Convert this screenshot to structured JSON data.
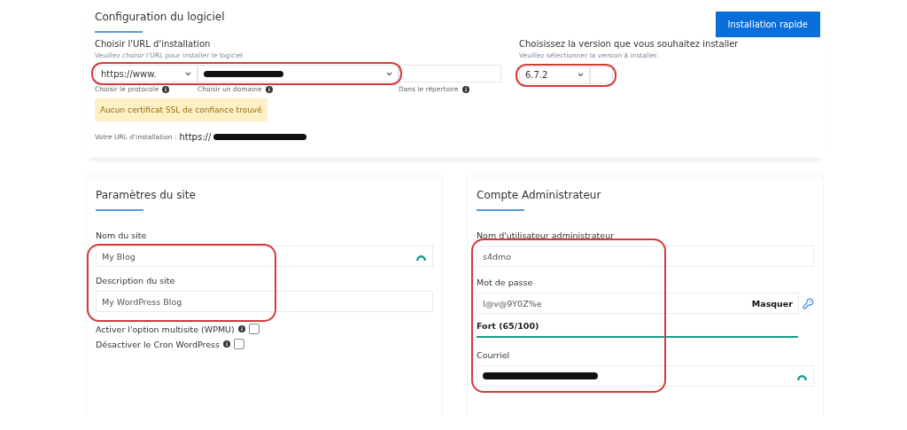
{
  "software_config": {
    "title": "Configuration du logiciel",
    "quick_install_button": "Installation rapide",
    "url": {
      "label": "Choisir l'URL d'installation",
      "hint": "Veuillez choisir l'URL pour installer le logiciel",
      "protocol": "https://www.",
      "domain_redacted": true,
      "highlighted": true,
      "captions": [
        "Choisir le protocole",
        "Choisir un domaine",
        "Dans le répertoire"
      ]
    },
    "version": {
      "label": "Choisissez la version que vous souhaitez installer",
      "hint": "Veuillez sélectionner la version à installer.",
      "value": "6.7.2",
      "highlighted": true
    },
    "ssl_warning": "Aucun certificat SSL de confiance trouvé",
    "install_url": {
      "label": "Votre URL d'installation :",
      "value": "https://",
      "redacted": true
    }
  },
  "site_settings": {
    "title": "Paramètres du site",
    "highlighted": true,
    "fields": [
      {
        "label": "Nom du site",
        "value": "My Blog",
        "assist_icon": true
      },
      {
        "label": "Description du site",
        "value": "My WordPress Blog",
        "assist_icon": false
      }
    ],
    "options": [
      {
        "label": "Activer l'option multisite (WPMU)",
        "checked": false
      },
      {
        "label": "Désactiver le Cron WordPress",
        "checked": false
      }
    ]
  },
  "admin_account": {
    "title": "Compte Administrateur",
    "highlighted": true,
    "username": {
      "label": "Nom d'utilisateur administrateur",
      "value": "s4dmo"
    },
    "password": {
      "label": "Mot de passe",
      "value": "l@v@9Y0Z%e",
      "toggle": "Masquer",
      "strength": "Fort (65/100)",
      "level": 1
    },
    "email": {
      "label": "Courriel",
      "redacted": true
    }
  }
}
